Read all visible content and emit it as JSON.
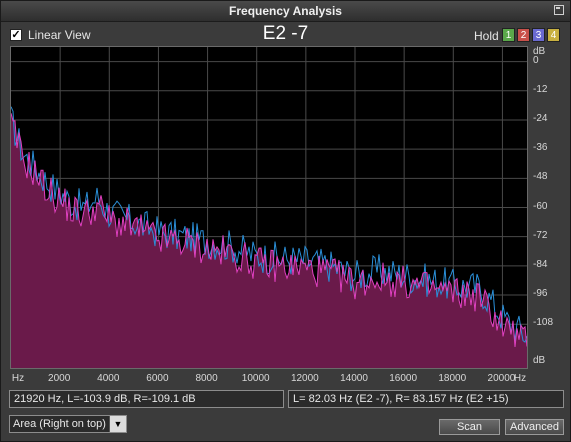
{
  "window": {
    "title": "Frequency Analysis"
  },
  "toolbar": {
    "linear_view_label": "Linear View",
    "linear_view_checked": true,
    "note": "E2 -7",
    "hold_label": "Hold",
    "hold_buttons": [
      {
        "label": "1",
        "color": "#5aa84a"
      },
      {
        "label": "2",
        "color": "#c8504a"
      },
      {
        "label": "3",
        "color": "#6a6ad0"
      },
      {
        "label": "4",
        "color": "#c8b040"
      }
    ]
  },
  "chart_data": {
    "type": "area",
    "x_unit": "Hz",
    "y_unit": "dB",
    "xlim": [
      0,
      21000
    ],
    "ylim": [
      -126,
      6
    ],
    "x_ticks": [
      "Hz",
      "2000",
      "4000",
      "6000",
      "8000",
      "10000",
      "12000",
      "14000",
      "16000",
      "18000",
      "20000",
      "Hz"
    ],
    "y_ticks": [
      "dB",
      "0",
      "-12",
      "-24",
      "-36",
      "-48",
      "-60",
      "-72",
      "-84",
      "-96",
      "-108",
      "dB"
    ],
    "grid": true,
    "series": [
      {
        "channel": "R",
        "color": "#2a8fd8",
        "x": [
          0,
          500,
          1000,
          1500,
          2000,
          2500,
          3000,
          3500,
          4000,
          5000,
          6000,
          7000,
          8000,
          9000,
          10000,
          11000,
          12000,
          13000,
          14000,
          15000,
          16000,
          17000,
          18000,
          19000,
          19500,
          20000,
          21000
        ],
        "y": [
          -24,
          -38,
          -44,
          -50,
          -54,
          -58,
          -60,
          -56,
          -62,
          -66,
          -70,
          -72,
          -74,
          -76,
          -80,
          -81,
          -82,
          -84,
          -88,
          -86,
          -88,
          -90,
          -92,
          -93,
          -98,
          -105,
          -113
        ]
      },
      {
        "channel": "L",
        "color": "#e040c0",
        "fill": "#6a1a4a",
        "x": [
          0,
          500,
          1000,
          1500,
          2000,
          2500,
          3000,
          3500,
          4000,
          5000,
          6000,
          7000,
          8000,
          9000,
          10000,
          11000,
          12000,
          13000,
          14000,
          15000,
          16000,
          17000,
          18000,
          19000,
          19500,
          20000,
          21000
        ],
        "y": [
          -26,
          -40,
          -46,
          -53,
          -57,
          -61,
          -63,
          -59,
          -65,
          -68,
          -73,
          -74,
          -77,
          -79,
          -83,
          -84,
          -85,
          -87,
          -91,
          -89,
          -91,
          -93,
          -95,
          -96,
          -102,
          -108,
          -116
        ]
      }
    ]
  },
  "status": {
    "cursor_readout": "21920 Hz, L=-103.9 dB, R=-109.1 dB",
    "peak_readout": "L=  82.03 Hz (E2 -7), R= 83.157 Hz (E2 +15)"
  },
  "bottom": {
    "view_mode": "Area (Right on top)",
    "scan_label": "Scan",
    "advanced_label": "Advanced"
  }
}
